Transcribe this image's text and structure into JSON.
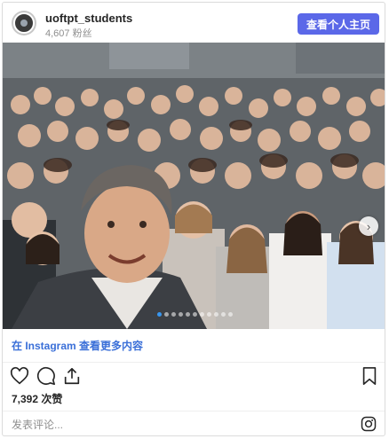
{
  "header": {
    "username": "uoftpt_students",
    "followers": "4,607 粉丝",
    "view_profile_label": "查看个人主页"
  },
  "photo": {
    "carousel_dots": 11,
    "active_dot": 0
  },
  "more_link": "在 Instagram 查看更多内容",
  "likes": "7,392 次赞",
  "comment_placeholder": "发表评论..."
}
